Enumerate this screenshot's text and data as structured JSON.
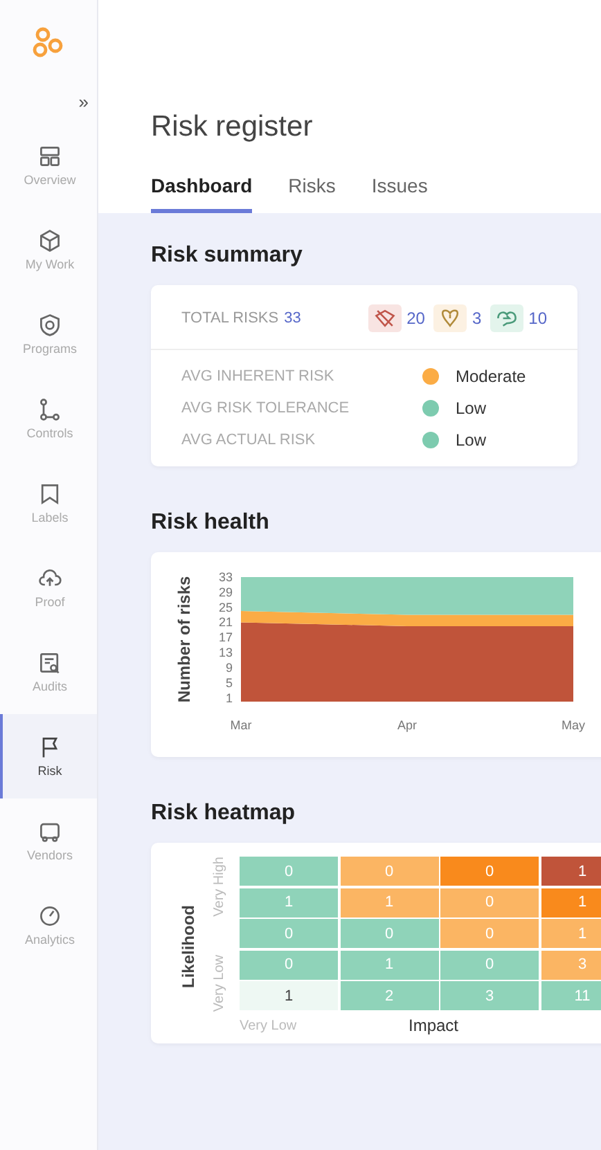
{
  "sidebar": {
    "expand_icon": "»",
    "items": [
      {
        "label": "Overview",
        "selected": false
      },
      {
        "label": "My Work",
        "selected": false
      },
      {
        "label": "Programs",
        "selected": false
      },
      {
        "label": "Controls",
        "selected": false
      },
      {
        "label": "Labels",
        "selected": false
      },
      {
        "label": "Proof",
        "selected": false
      },
      {
        "label": "Audits",
        "selected": false
      },
      {
        "label": "Risk",
        "selected": true
      },
      {
        "label": "Vendors",
        "selected": false
      },
      {
        "label": "Analytics",
        "selected": false
      }
    ]
  },
  "page": {
    "title": "Risk register"
  },
  "tabs": [
    {
      "label": "Dashboard",
      "selected": true
    },
    {
      "label": "Risks",
      "selected": false
    },
    {
      "label": "Issues",
      "selected": false
    }
  ],
  "summary": {
    "title": "Risk summary",
    "total_label": "TOTAL RISKS",
    "total": "33",
    "badges": [
      {
        "kind": "high",
        "count": "20"
      },
      {
        "kind": "medium",
        "count": "3"
      },
      {
        "kind": "low",
        "count": "10"
      }
    ],
    "rows": [
      {
        "label": "AVG INHERENT RISK",
        "color": "#fbac45",
        "value": "Moderate"
      },
      {
        "label": "AVG RISK TOLERANCE",
        "color": "#7dcbaf",
        "value": "Low"
      },
      {
        "label": "AVG ACTUAL RISK",
        "color": "#7dcbaf",
        "value": "Low"
      }
    ]
  },
  "health": {
    "title": "Risk health",
    "chart_data": {
      "type": "area",
      "stacked": true,
      "ylabel": "Number of risks",
      "categories": [
        "Mar",
        "Apr",
        "May"
      ],
      "yticks": [
        1,
        5,
        9,
        13,
        17,
        21,
        25,
        29,
        33
      ],
      "ylim": [
        0,
        33
      ],
      "series": [
        {
          "color": "#c0543a",
          "values": [
            21,
            20,
            20
          ]
        },
        {
          "color": "#fbac45",
          "values": [
            3,
            3,
            3
          ]
        },
        {
          "color": "#8fd3b9",
          "values": [
            9,
            10,
            10
          ]
        }
      ]
    }
  },
  "heatmap": {
    "title": "Risk heatmap",
    "ylabel": "Likelihood",
    "xlabel": "Impact",
    "row_top_label": "Very High",
    "row_bottom_label": "Very Low",
    "col_first_label": "Very Low",
    "rows": [
      [
        {
          "value": "0",
          "color": "#8fd3b9"
        },
        {
          "value": "0",
          "color": "#fbb563"
        },
        {
          "value": "0",
          "color": "#f98a1c"
        },
        {
          "value": "1",
          "color": "#c0543a"
        }
      ],
      [
        {
          "value": "1",
          "color": "#8fd3b9"
        },
        {
          "value": "1",
          "color": "#fbb563"
        },
        {
          "value": "0",
          "color": "#fbb563"
        },
        {
          "value": "1",
          "color": "#f98a1c"
        }
      ],
      [
        {
          "value": "0",
          "color": "#8fd3b9"
        },
        {
          "value": "0",
          "color": "#8fd3b9"
        },
        {
          "value": "0",
          "color": "#fbb563"
        },
        {
          "value": "1",
          "color": "#fbb563"
        }
      ],
      [
        {
          "value": "0",
          "color": "#8fd3b9"
        },
        {
          "value": "1",
          "color": "#8fd3b9"
        },
        {
          "value": "0",
          "color": "#8fd3b9"
        },
        {
          "value": "3",
          "color": "#fbb563"
        }
      ],
      [
        {
          "value": "1",
          "color": "#eef8f3"
        },
        {
          "value": "2",
          "color": "#8fd3b9"
        },
        {
          "value": "3",
          "color": "#8fd3b9"
        },
        {
          "value": "11",
          "color": "#8fd3b9"
        }
      ]
    ]
  }
}
